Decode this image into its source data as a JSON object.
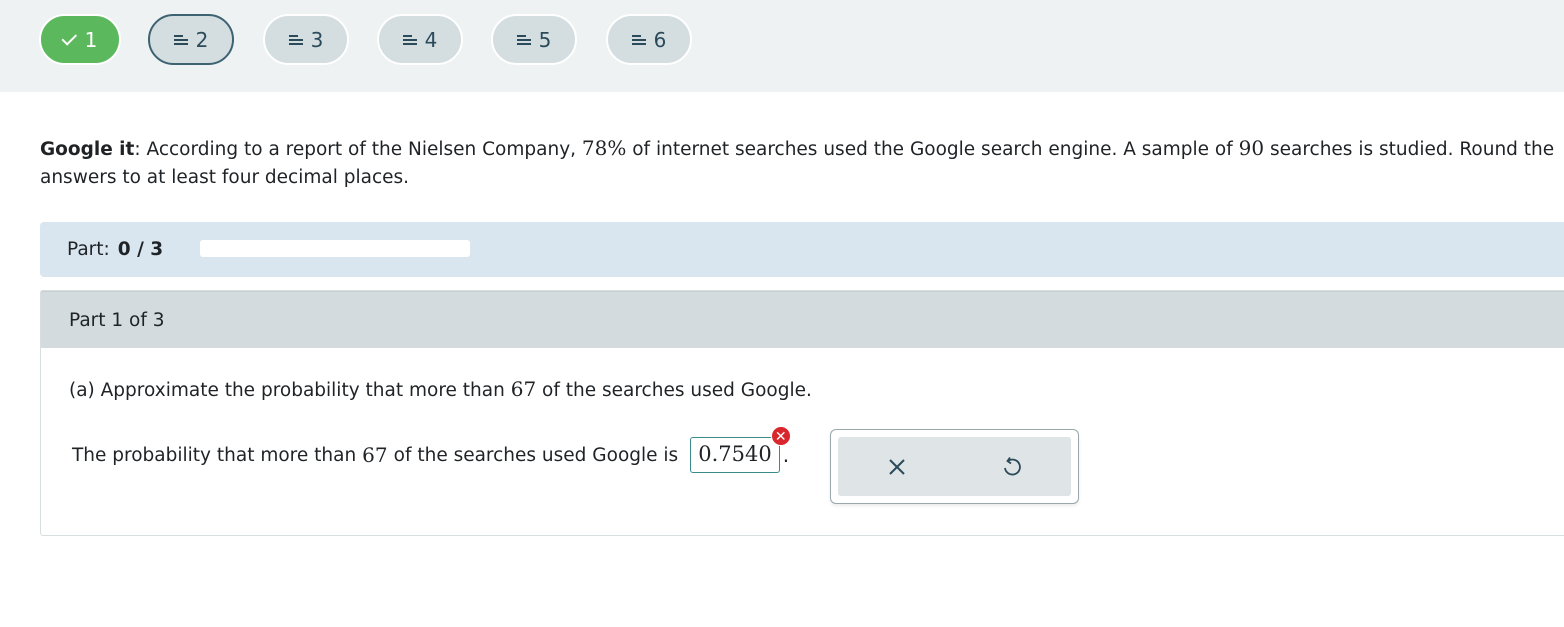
{
  "nav": {
    "questions": [
      {
        "label": "1",
        "state": "completed"
      },
      {
        "label": "2",
        "state": "current"
      },
      {
        "label": "3",
        "state": "pending"
      },
      {
        "label": "4",
        "state": "pending"
      },
      {
        "label": "5",
        "state": "pending"
      },
      {
        "label": "6",
        "state": "pending"
      }
    ]
  },
  "problem": {
    "title": "Google it",
    "text_1": ": According to a report of the Nielsen Company, ",
    "pct": "78%",
    "text_2": " of internet searches used the Google search engine. A sample of ",
    "n": "90",
    "text_3": " searches is studied. Round the answers to at least four decimal places."
  },
  "progress": {
    "label": "Part:",
    "value": "0 / 3",
    "fraction": 0
  },
  "part": {
    "header": "Part 1 of 3",
    "question_pre": "(a) Approximate the probability that more than ",
    "question_num": "67",
    "question_post": " of the searches used Google.",
    "answer_pre": "The probability that more than ",
    "answer_num": "67",
    "answer_post": " of the searches used Google is",
    "answer_value": "0.7540",
    "answer_period": ".",
    "answer_status": "incorrect"
  },
  "tools": {
    "clear_icon": "close-icon",
    "undo_icon": "undo-icon"
  },
  "colors": {
    "completed": "#5cb85c",
    "error": "#d9262c",
    "partbar": "#dae6ef",
    "accent": "#3a8c8c"
  }
}
